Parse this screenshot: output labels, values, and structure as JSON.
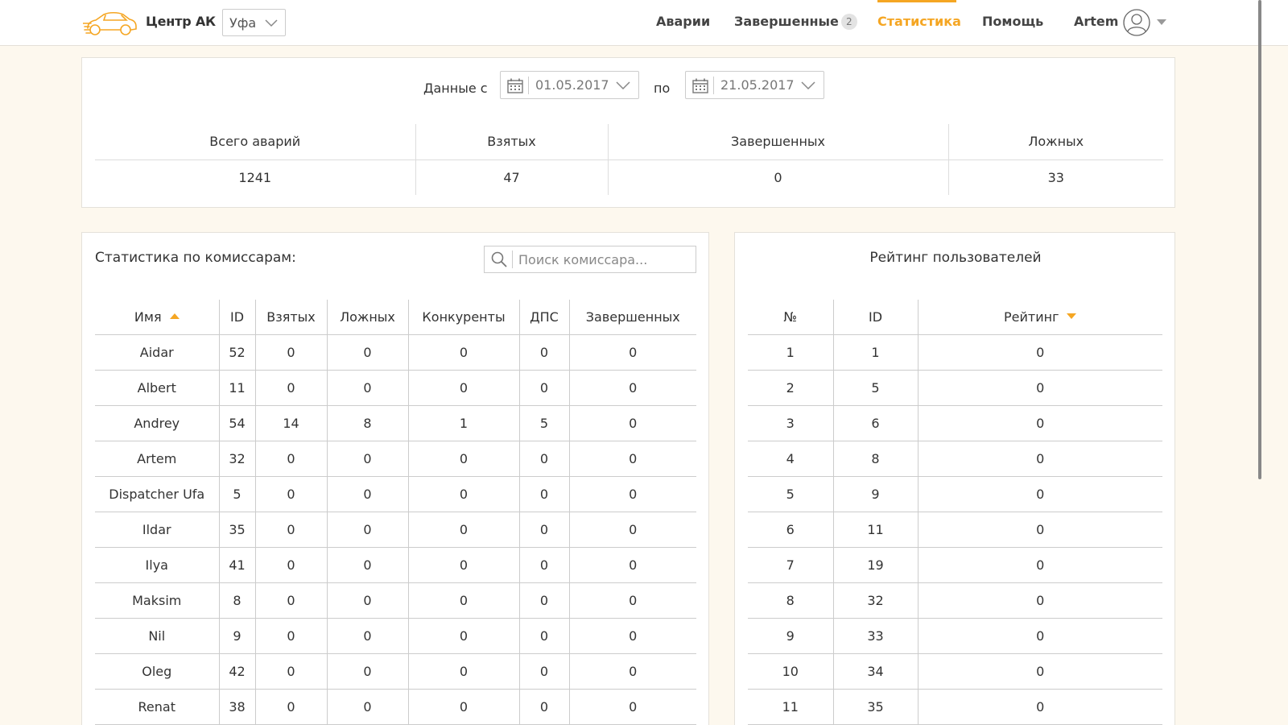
{
  "header": {
    "brand": "Центр АК",
    "city": "Уфа",
    "nav": {
      "accidents": "Аварии",
      "completed": "Завершенные",
      "completed_count": "2",
      "statistics": "Статистика",
      "help": "Помощь"
    },
    "user_name": "Artem"
  },
  "colors": {
    "accent": "#f5a623",
    "background": "#fdf8ee"
  },
  "summary": {
    "date_from_label": "Данные с",
    "date_from": "01.05.2017",
    "date_to_label": "по",
    "date_to": "21.05.2017",
    "columns": [
      "Всего аварий",
      "Взятых",
      "Завершенных",
      "Ложных"
    ],
    "values": [
      "1241",
      "47",
      "0",
      "33"
    ]
  },
  "commissars": {
    "title": "Статистика по комиссарам:",
    "search_placeholder": "Поиск комиссара...",
    "columns": [
      "Имя",
      "ID",
      "Взятых",
      "Ложных",
      "Конкуренты",
      "ДПС",
      "Завершенных"
    ],
    "rows": [
      [
        "Aidar",
        "52",
        "0",
        "0",
        "0",
        "0",
        "0"
      ],
      [
        "Albert",
        "11",
        "0",
        "0",
        "0",
        "0",
        "0"
      ],
      [
        "Andrey",
        "54",
        "14",
        "8",
        "1",
        "5",
        "0"
      ],
      [
        "Artem",
        "32",
        "0",
        "0",
        "0",
        "0",
        "0"
      ],
      [
        "Dispatcher Ufa",
        "5",
        "0",
        "0",
        "0",
        "0",
        "0"
      ],
      [
        "Ildar",
        "35",
        "0",
        "0",
        "0",
        "0",
        "0"
      ],
      [
        "Ilya",
        "41",
        "0",
        "0",
        "0",
        "0",
        "0"
      ],
      [
        "Maksim",
        "8",
        "0",
        "0",
        "0",
        "0",
        "0"
      ],
      [
        "Nil",
        "9",
        "0",
        "0",
        "0",
        "0",
        "0"
      ],
      [
        "Oleg",
        "42",
        "0",
        "0",
        "0",
        "0",
        "0"
      ],
      [
        "Renat",
        "38",
        "0",
        "0",
        "0",
        "0",
        "0"
      ]
    ]
  },
  "rating": {
    "title": "Рейтинг пользователей",
    "columns": [
      "№",
      "ID",
      "Рейтинг"
    ],
    "rows": [
      [
        "1",
        "1",
        "0"
      ],
      [
        "2",
        "5",
        "0"
      ],
      [
        "3",
        "6",
        "0"
      ],
      [
        "4",
        "8",
        "0"
      ],
      [
        "5",
        "9",
        "0"
      ],
      [
        "6",
        "11",
        "0"
      ],
      [
        "7",
        "19",
        "0"
      ],
      [
        "8",
        "32",
        "0"
      ],
      [
        "9",
        "33",
        "0"
      ],
      [
        "10",
        "34",
        "0"
      ],
      [
        "11",
        "35",
        "0"
      ]
    ]
  }
}
